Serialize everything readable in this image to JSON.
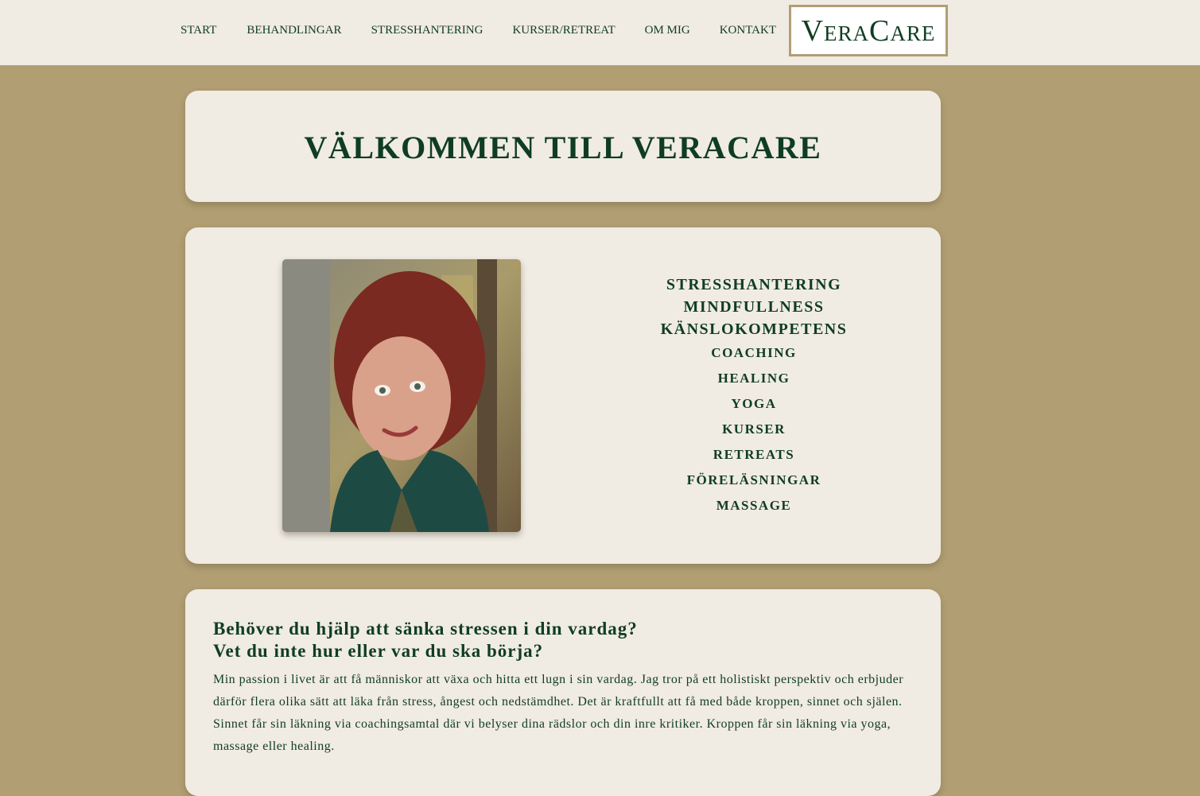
{
  "nav": {
    "items": [
      "START",
      "BEHANDLINGAR",
      "STRESSHANTERING",
      "KURSER/RETREAT",
      "OM MIG",
      "KONTAKT"
    ]
  },
  "logo": {
    "text": "VeraCare"
  },
  "hero": {
    "title": "VÄLKOMMEN TILL VERACARE"
  },
  "services": {
    "major": [
      "STRESSHANTERING",
      "MINDFULLNESS",
      "KÄNSLOKOMPETENS"
    ],
    "minor": [
      "COACHING",
      "HEALING",
      "YOGA",
      "KURSER",
      "RETREATS",
      "FÖRELÄSNINGAR",
      "MASSAGE"
    ]
  },
  "intro": {
    "heading_line1": "Behöver du hjälp att sänka stressen i din vardag?",
    "heading_line2": "Vet du inte hur eller var du ska börja?",
    "paragraph": "Min passion i livet är att få människor att växa och hitta ett lugn i sin vardag. Jag tror på ett holistiskt perspektiv och erbjuder därför flera olika sätt att läka från stress, ångest och nedstämdhet. Det är kraftfullt att få med både kroppen, sinnet och själen. Sinnet får sin läkning via coachingsamtal där vi belyser dina rädslor och din inre kritiker. Kroppen får sin läkning via yoga, massage eller healing."
  },
  "colors": {
    "accent": "#0f3d22",
    "background": "#b19e72",
    "card": "#f0ebe3"
  }
}
